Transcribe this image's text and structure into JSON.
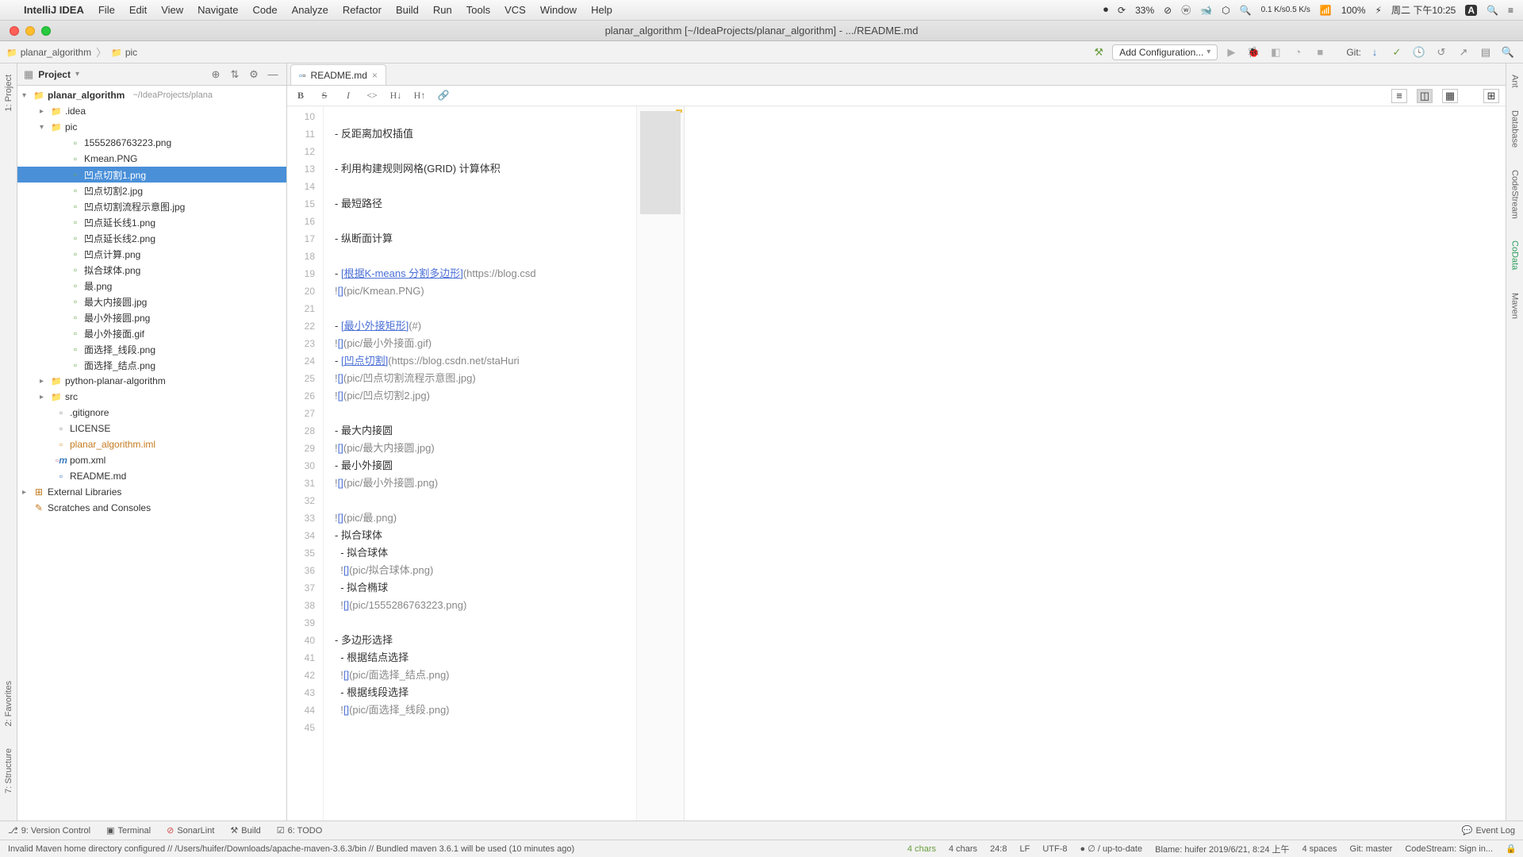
{
  "menubar": {
    "app": "IntelliJ IDEA",
    "items": [
      "File",
      "Edit",
      "View",
      "Navigate",
      "Code",
      "Analyze",
      "Refactor",
      "Build",
      "Run",
      "Tools",
      "VCS",
      "Window",
      "Help"
    ],
    "battery": "33%",
    "net_up": "0.1 K/s",
    "net_dn": "0.5 K/s",
    "wifi_pct": "100%",
    "charge_icon": "⚡︎",
    "clock": "周二 下午10:25"
  },
  "window": {
    "title": "planar_algorithm [~/IdeaProjects/planar_algorithm] - .../README.md"
  },
  "breadcrumb": {
    "root": "planar_algorithm",
    "path": "pic"
  },
  "toolbar": {
    "add_config": "Add Configuration...",
    "git_label": "Git:"
  },
  "project": {
    "title": "Project",
    "root": "planar_algorithm",
    "root_hint": "~/IdeaProjects/plana",
    "idea": ".idea",
    "pic": "pic",
    "pic_files": [
      "1555286763223.png",
      "Kmean.PNG",
      "凹点切割1.png",
      "凹点切割2.jpg",
      "凹点切割流程示意图.jpg",
      "凹点延长线1.png",
      "凹点延长线2.png",
      "凹点计算.png",
      "拟合球体.png",
      "最.png",
      "最大内接圆.jpg",
      "最小外接圆.png",
      "最小外接面.gif",
      "面选择_线段.png",
      "面选择_结点.png"
    ],
    "selected_index": 2,
    "python_pkg": "python-planar-algorithm",
    "src": "src",
    "gitignore": ".gitignore",
    "license": "LICENSE",
    "iml": "planar_algorithm.iml",
    "pom": "pom.xml",
    "readme": "README.md",
    "ext_libs": "External Libraries",
    "scratches": "Scratches and Consoles"
  },
  "editor": {
    "tab": "README.md",
    "first_line": 10,
    "lines": [
      "",
      "- 反距离加权插值",
      "",
      "- 利用构建规则网格(GRID) 计算体积",
      "",
      "- 最短路径",
      "",
      "- 纵断面计算",
      "",
      "- [根据K-means 分割多边形](https://blog.csd",
      "![](pic/Kmean.PNG)",
      "",
      "- [最小外接矩形](#)",
      "![](pic/最小外接面.gif)",
      "- [凹点切割](https://blog.csdn.net/staHuri",
      "![](pic/凹点切割流程示意图.jpg)",
      "![](pic/凹点切割2.jpg)",
      "",
      "- 最大内接圆",
      "![](pic/最大内接圆.jpg)",
      "- 最小外接圆",
      "![](pic/最小外接圆.png)",
      "",
      "![](pic/最.png)",
      "- 拟合球体",
      "  - 拟合球体",
      "  ![](pic/拟合球体.png)",
      "  - 拟合椭球",
      "  ![](pic/1555286763223.png)",
      "",
      "- 多边形选择",
      "  - 根据结点选择",
      "  ![](pic/面选择_结点.png)",
      "  - 根据线段选择",
      "  ![](pic/面选择_线段.png)",
      ""
    ],
    "link_lines": [
      19,
      22,
      24
    ],
    "img_lines": [
      20,
      23,
      25,
      26,
      29,
      31,
      33,
      36,
      38,
      42,
      44
    ]
  },
  "bottom_tools": {
    "vc": "9: Version Control",
    "terminal": "Terminal",
    "sonar": "SonarLint",
    "build": "Build",
    "todo": "6: TODO",
    "event_log": "Event Log"
  },
  "status": {
    "msg": "Invalid Maven home directory configured // /Users/huifer/Downloads/apache-maven-3.6.3/bin // Bundled maven 3.6.1 will be used (10 minutes ago)",
    "chars": "4 chars",
    "pos": "24:8",
    "le": "LF",
    "enc": "UTF-8",
    "sync": "∅ / up-to-date",
    "blame": "Blame: huifer 2019/6/21, 8:24 上午",
    "indent": "4 spaces",
    "git": "Git: master",
    "codestream": "CodeStream: Sign in..."
  },
  "left_tool_labels": [
    "1: Project",
    "2: Favorites",
    "7: Structure"
  ],
  "right_tool_labels": [
    "Ant",
    "Database",
    "CodeStream",
    "CoData",
    "Maven"
  ]
}
